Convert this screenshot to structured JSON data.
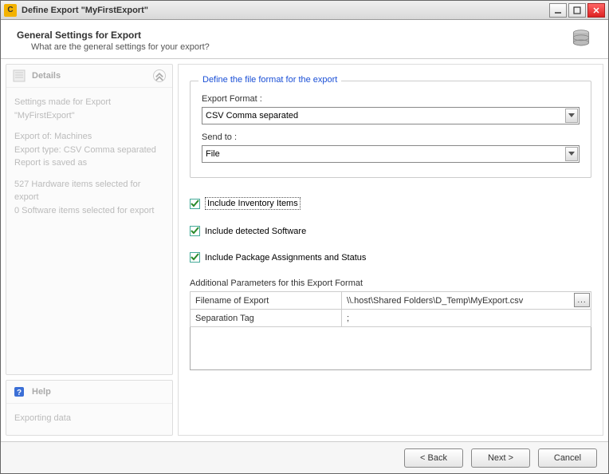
{
  "titlebar": {
    "app_icon_letter": "C",
    "title": "Define Export \"MyFirstExport\""
  },
  "header": {
    "title": "General Settings for Export",
    "subtitle": "What are the general settings for your export?"
  },
  "sidebar": {
    "details": {
      "title": "Details",
      "body": {
        "l1": "Settings made for Export \"MyFirstExport\"",
        "l2": "Export of: Machines",
        "l3": "Export type: CSV Comma separated",
        "l4": "Report is saved as",
        "l5": "527 Hardware items selected for export",
        "l6": "0 Software items selected for export"
      }
    },
    "help": {
      "title": "Help",
      "body": "Exporting data"
    }
  },
  "main": {
    "fieldset": {
      "legend": "Define the file format for the export",
      "format_label": "Export Format :",
      "format_value": "CSV Comma separated",
      "sendto_label": "Send to :",
      "sendto_value": "File"
    },
    "checks": {
      "inventory": "Include Inventory Items",
      "software": "Include detected Software",
      "packages": "Include Package Assignments and Status"
    },
    "params": {
      "label": "Additional Parameters for this Export Format",
      "rows": [
        {
          "key": "Filename of Export",
          "val": "\\\\.host\\Shared Folders\\D_Temp\\MyExport.csv"
        },
        {
          "key": "Separation Tag",
          "val": ";"
        }
      ]
    }
  },
  "footer": {
    "back": "< Back",
    "next": "Next >",
    "cancel": "Cancel"
  }
}
